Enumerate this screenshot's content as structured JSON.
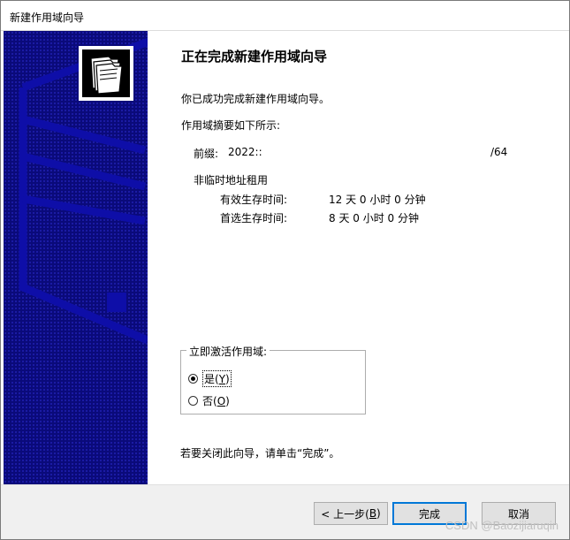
{
  "window": {
    "title": "新建作用域向导"
  },
  "page": {
    "heading": "正在完成新建作用域向导",
    "success_text": "你已成功完成新建作用域向导。",
    "summary_intro": "作用域摘要如下所示:",
    "prefix_label": "前缀:",
    "prefix_value": "2022::",
    "prefix_suffix": "/64",
    "lease_section": "非临时地址租用",
    "valid_lifetime_label": "有效生存时间:",
    "valid_lifetime_value": "12 天 0 小时 0 分钟",
    "preferred_lifetime_label": "首选生存时间:",
    "preferred_lifetime_value": "8 天 0 小时 0 分钟"
  },
  "activate": {
    "legend": "立即激活作用域:",
    "yes_text": "是(",
    "yes_key": "Y",
    "yes_close": ")",
    "no_text": "否(",
    "no_key": "O",
    "no_close": ")",
    "selected": "yes"
  },
  "closing_text": "若要关闭此向导，请单击“完成”。",
  "buttons": {
    "back_text": "< 上一步(",
    "back_key": "B",
    "back_close": ")",
    "finish": "完成",
    "cancel": "取消"
  },
  "watermark": "CSDN @Baozijiaruqin",
  "icons": {
    "logo": "folder-stack-icon"
  },
  "colors": {
    "sidebar": "#0a0a7a",
    "sidebar_lines": "#0e0ea8",
    "accent": "#0078d7"
  }
}
